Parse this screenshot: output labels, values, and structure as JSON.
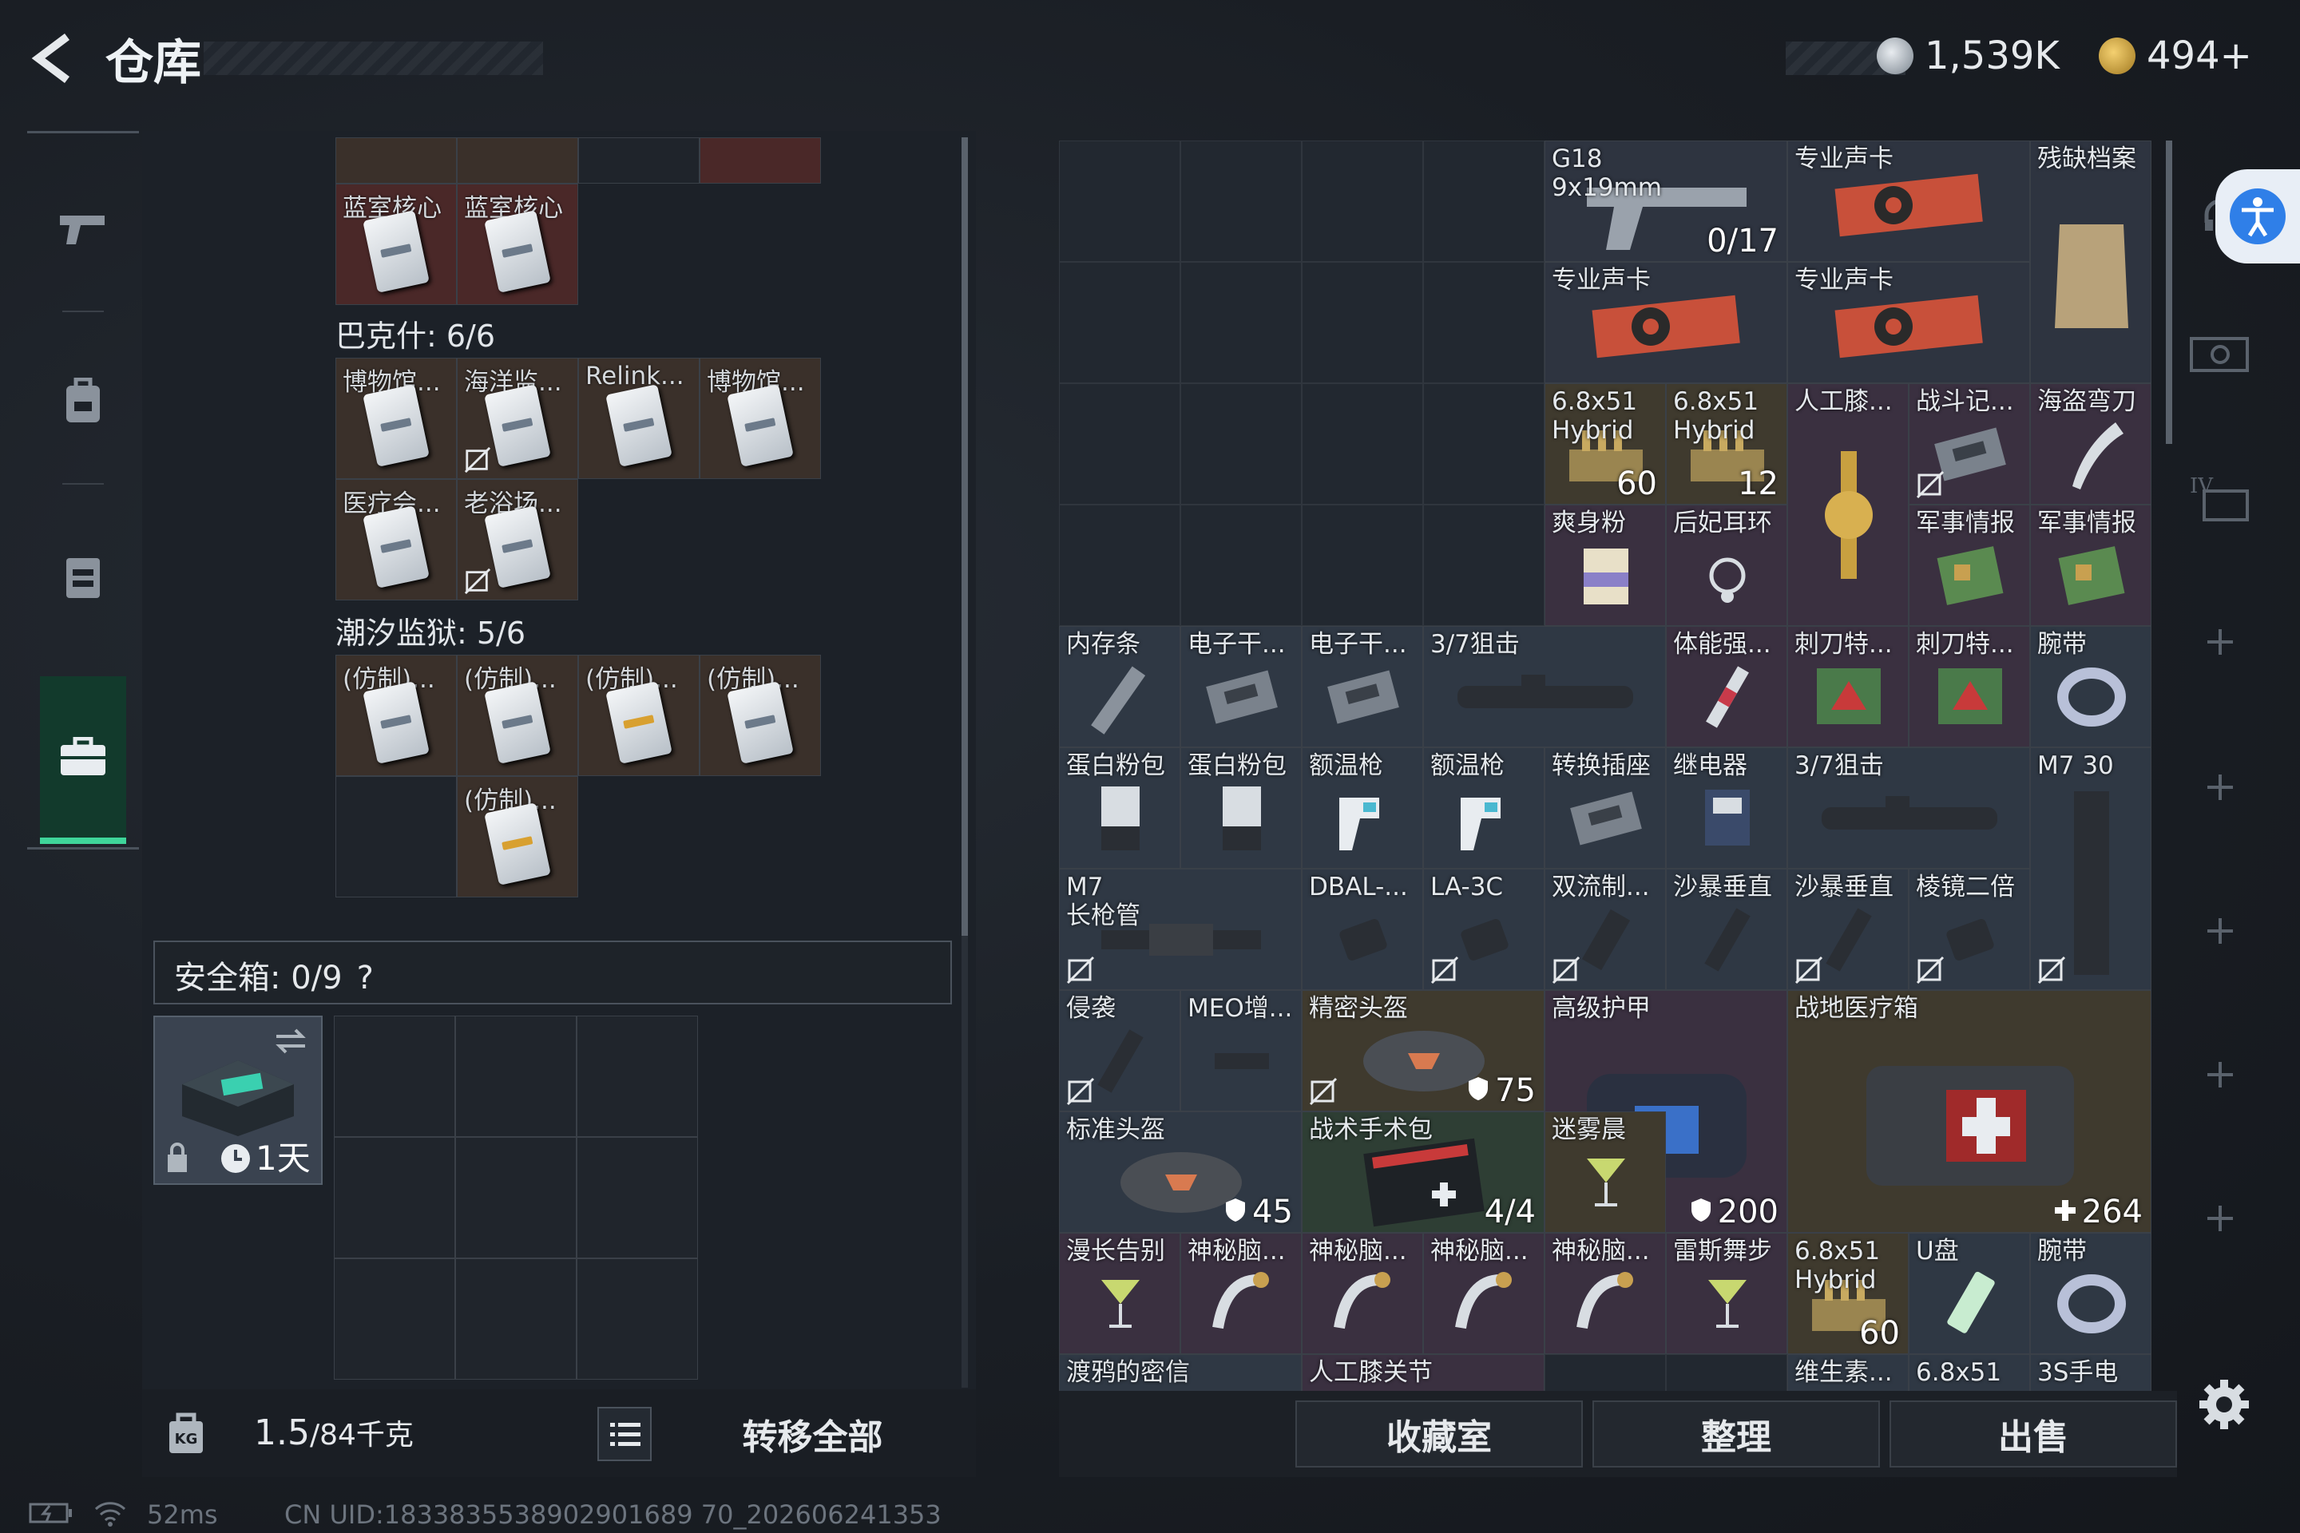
{
  "header": {
    "title": "仓库",
    "currency1": "1,539K",
    "currency2": "494+"
  },
  "left": {
    "top_row": [
      {
        "label": "",
        "color": "brown"
      },
      {
        "label": "",
        "color": "brown"
      },
      {
        "label": "",
        "color": "empty"
      },
      {
        "label": "",
        "color": "red"
      }
    ],
    "top_items": [
      {
        "label": "蓝室核心"
      },
      {
        "label": "蓝室核心"
      }
    ],
    "section1": "巴克什: 6/6",
    "grid1": [
      {
        "label": "博物馆...",
        "nt": false
      },
      {
        "label": "海洋监...",
        "nt": true
      },
      {
        "label": "Relink...",
        "nt": false
      },
      {
        "label": "博物馆...",
        "nt": false
      },
      {
        "label": "医疗会...",
        "nt": false
      },
      {
        "label": "老浴场...",
        "nt": true
      }
    ],
    "section2": "潮汐监狱: 5/6",
    "grid2": [
      {
        "label": "(仿制)...",
        "gold": false
      },
      {
        "label": "(仿制)...",
        "gold": false
      },
      {
        "label": "(仿制)...",
        "gold": true
      },
      {
        "label": "(仿制)...",
        "gold": false
      },
      {
        "label": "",
        "gold": false,
        "empty": true
      },
      {
        "label": "(仿制)...",
        "gold": true
      }
    ],
    "safe_label": "安全箱:  0/9",
    "safe_help": "?",
    "safebox_time": "1天",
    "weight": "1.5",
    "weight_cap": "/84千克",
    "transfer_all": "转移全部"
  },
  "right": {
    "items": [
      {
        "label": "G18\n9x19mm",
        "count": "0/17",
        "c": 6,
        "r": 0,
        "w": 2,
        "h": 1,
        "bg": "#2e3440",
        "icon": "pistol"
      },
      {
        "label": "专业声卡",
        "count": "",
        "c": 8,
        "r": 0,
        "w": 2,
        "h": 1,
        "bg": "#2e3440",
        "icon": "gpu"
      },
      {
        "label": "残缺档案",
        "count": "",
        "c": 10,
        "r": 0,
        "w": 1,
        "h": 2,
        "bg": "#2e3440",
        "icon": "bag"
      },
      {
        "label": "专业声卡",
        "count": "",
        "c": 6,
        "r": 1,
        "w": 2,
        "h": 1,
        "bg": "#2e3440",
        "icon": "gpu"
      },
      {
        "label": "专业声卡",
        "count": "",
        "c": 8,
        "r": 1,
        "w": 2,
        "h": 1,
        "bg": "#2e3440",
        "icon": "gpu"
      },
      {
        "label": "6.8x51\nHybrid",
        "count": "60",
        "c": 6,
        "r": 2,
        "w": 1,
        "h": 1,
        "bg": "#3f3a2e",
        "icon": "ammo"
      },
      {
        "label": "6.8x51\nHybrid",
        "count": "12",
        "c": 7,
        "r": 2,
        "w": 1,
        "h": 1,
        "bg": "#3f3a2e",
        "icon": "ammo"
      },
      {
        "label": "人工膝...",
        "count": "",
        "c": 8,
        "r": 2,
        "w": 1,
        "h": 2,
        "bg": "#3a3040",
        "icon": "knee"
      },
      {
        "label": "战斗记...",
        "count": "",
        "c": 9,
        "r": 2,
        "w": 1,
        "h": 1,
        "bg": "#3a3040",
        "icon": "device",
        "nt": true
      },
      {
        "label": "海盗弯刀",
        "count": "",
        "c": 10,
        "r": 2,
        "w": 1,
        "h": 1,
        "bg": "#3a3040",
        "icon": "knife"
      },
      {
        "label": "爽身粉",
        "count": "",
        "c": 6,
        "r": 3,
        "w": 1,
        "h": 1,
        "bg": "#3a3040",
        "icon": "can"
      },
      {
        "label": "后妃耳环",
        "count": "",
        "c": 7,
        "r": 3,
        "w": 1,
        "h": 1,
        "bg": "#3a3040",
        "icon": "earring"
      },
      {
        "label": "军事情报",
        "count": "",
        "c": 9,
        "r": 3,
        "w": 1,
        "h": 1,
        "bg": "#3a3040",
        "icon": "board"
      },
      {
        "label": "军事情报",
        "count": "",
        "c": 10,
        "r": 3,
        "w": 1,
        "h": 1,
        "bg": "#3a3040",
        "icon": "board"
      },
      {
        "label": "内存条",
        "count": "",
        "c": 2,
        "r": 4,
        "w": 1,
        "h": 1,
        "bg": "#2f3844",
        "icon": "stick"
      },
      {
        "label": "电子干...",
        "count": "",
        "c": 3,
        "r": 4,
        "w": 1,
        "h": 1,
        "bg": "#2f3844",
        "icon": "device"
      },
      {
        "label": "电子干...",
        "count": "",
        "c": 4,
        "r": 4,
        "w": 1,
        "h": 1,
        "bg": "#2f3844",
        "icon": "device"
      },
      {
        "label": "3/7狙击",
        "count": "",
        "c": 5,
        "r": 4,
        "w": 2,
        "h": 1,
        "bg": "#2f3844",
        "icon": "scope"
      },
      {
        "label": "体能强...",
        "count": "",
        "c": 7,
        "r": 4,
        "w": 1,
        "h": 1,
        "bg": "#3a3040",
        "icon": "syringe"
      },
      {
        "label": "刺刀特...",
        "count": "",
        "c": 8,
        "r": 4,
        "w": 1,
        "h": 1,
        "bg": "#3a3040",
        "icon": "pack"
      },
      {
        "label": "刺刀特...",
        "count": "",
        "c": 9,
        "r": 4,
        "w": 1,
        "h": 1,
        "bg": "#3a3040",
        "icon": "pack"
      },
      {
        "label": "腕带",
        "count": "",
        "c": 10,
        "r": 4,
        "w": 1,
        "h": 1,
        "bg": "#2f3844",
        "icon": "band"
      },
      {
        "label": "蛋白粉包",
        "count": "",
        "c": 2,
        "r": 5,
        "w": 1,
        "h": 1,
        "bg": "#2f3844",
        "icon": "pouch"
      },
      {
        "label": "蛋白粉包",
        "count": "",
        "c": 3,
        "r": 5,
        "w": 1,
        "h": 1,
        "bg": "#2f3844",
        "icon": "pouch"
      },
      {
        "label": "额温枪",
        "count": "",
        "c": 4,
        "r": 5,
        "w": 1,
        "h": 1,
        "bg": "#2f3844",
        "icon": "thermo"
      },
      {
        "label": "额温枪",
        "count": "",
        "c": 5,
        "r": 5,
        "w": 1,
        "h": 1,
        "bg": "#2f3844",
        "icon": "thermo"
      },
      {
        "label": "转换插座",
        "count": "",
        "c": 6,
        "r": 5,
        "w": 1,
        "h": 1,
        "bg": "#2f3844",
        "icon": "device"
      },
      {
        "label": "继电器",
        "count": "",
        "c": 7,
        "r": 5,
        "w": 1,
        "h": 1,
        "bg": "#2f3844",
        "icon": "relay"
      },
      {
        "label": "3/7狙击",
        "count": "",
        "c": 8,
        "r": 5,
        "w": 2,
        "h": 1,
        "bg": "#2f3844",
        "icon": "scope"
      },
      {
        "label": "M7 30",
        "count": "",
        "c": 10,
        "r": 5,
        "w": 1,
        "h": 2,
        "bg": "#2f3844",
        "icon": "mag",
        "nt": true
      },
      {
        "label": "M7\n长枪管",
        "count": "",
        "c": 2,
        "r": 6,
        "w": 2,
        "h": 1,
        "bg": "#2f3844",
        "icon": "barrel",
        "nt": true
      },
      {
        "label": "DBAL-...",
        "count": "",
        "c": 4,
        "r": 6,
        "w": 1,
        "h": 1,
        "bg": "#2f3844",
        "icon": "laser"
      },
      {
        "label": "LA-3C",
        "count": "",
        "c": 5,
        "r": 6,
        "w": 1,
        "h": 1,
        "bg": "#2f3844",
        "icon": "laser",
        "nt": true
      },
      {
        "label": "双流制...",
        "count": "",
        "c": 6,
        "r": 6,
        "w": 1,
        "h": 1,
        "bg": "#2f3844",
        "icon": "muzzle",
        "nt": true
      },
      {
        "label": "沙暴垂直",
        "count": "",
        "c": 7,
        "r": 6,
        "w": 1,
        "h": 1,
        "bg": "#2f3844",
        "icon": "grip"
      },
      {
        "label": "沙暴垂直",
        "count": "",
        "c": 8,
        "r": 6,
        "w": 1,
        "h": 1,
        "bg": "#2f3844",
        "icon": "grip",
        "nt": true
      },
      {
        "label": "棱镜二倍",
        "count": "",
        "c": 9,
        "r": 6,
        "w": 1,
        "h": 1,
        "bg": "#2f3844",
        "icon": "laser",
        "nt": true
      },
      {
        "label": "侵袭",
        "count": "",
        "c": 2,
        "r": 7,
        "w": 1,
        "h": 1,
        "bg": "#2f3844",
        "icon": "grip",
        "nt": true
      },
      {
        "label": "MEO增...",
        "count": "",
        "c": 3,
        "r": 7,
        "w": 1,
        "h": 1,
        "bg": "#2f3844",
        "icon": "rail"
      },
      {
        "label": "精密头盔",
        "count": "75",
        "c": 4,
        "r": 7,
        "w": 2,
        "h": 1,
        "bg": "#3f3a2e",
        "icon": "helmet",
        "nt": true,
        "shield": true
      },
      {
        "label": "高级护甲",
        "count": "200",
        "c": 6,
        "r": 7,
        "w": 2,
        "h": 2,
        "bg": "#3a3040",
        "icon": "armor",
        "nt": true,
        "shield": true
      },
      {
        "label": "战地医疗箱",
        "count": "264",
        "c": 8,
        "r": 7,
        "w": 3,
        "h": 2,
        "bg": "#3f3a2e",
        "icon": "medkit",
        "plus": true
      },
      {
        "label": "标准头盔",
        "count": "45",
        "c": 2,
        "r": 8,
        "w": 2,
        "h": 1,
        "bg": "#2f3844",
        "icon": "helmet",
        "shield": true
      },
      {
        "label": "战术手术包",
        "count": "4/4",
        "c": 4,
        "r": 8,
        "w": 2,
        "h": 1,
        "bg": "#2e3e34",
        "icon": "surgery"
      },
      {
        "label": "迷雾晨",
        "count": "",
        "c": 6,
        "r": 8,
        "w": 1,
        "h": 1,
        "bg": "#3f3a2e",
        "icon": "cocktail"
      },
      {
        "label": "漫长告别",
        "count": "",
        "c": 2,
        "r": 9,
        "w": 1,
        "h": 1,
        "bg": "#3a3040",
        "icon": "cocktail"
      },
      {
        "label": "神秘脑...",
        "count": "",
        "c": 3,
        "r": 9,
        "w": 1,
        "h": 1,
        "bg": "#3a3040",
        "icon": "brain"
      },
      {
        "label": "神秘脑...",
        "count": "",
        "c": 4,
        "r": 9,
        "w": 1,
        "h": 1,
        "bg": "#3a3040",
        "icon": "brain"
      },
      {
        "label": "神秘脑...",
        "count": "",
        "c": 5,
        "r": 9,
        "w": 1,
        "h": 1,
        "bg": "#3a3040",
        "icon": "brain"
      },
      {
        "label": "神秘脑...",
        "count": "",
        "c": 6,
        "r": 9,
        "w": 1,
        "h": 1,
        "bg": "#3a3040",
        "icon": "brain"
      },
      {
        "label": "雷斯舞步",
        "count": "",
        "c": 7,
        "r": 9,
        "w": 1,
        "h": 1,
        "bg": "#3a3040",
        "icon": "cocktail"
      },
      {
        "label": "6.8x51\nHybrid",
        "count": "60",
        "c": 8,
        "r": 9,
        "w": 1,
        "h": 1,
        "bg": "#3f3a2e",
        "icon": "ammo"
      },
      {
        "label": "U盘",
        "count": "",
        "c": 9,
        "r": 9,
        "w": 1,
        "h": 1,
        "bg": "#2f3844",
        "icon": "usb"
      },
      {
        "label": "腕带",
        "count": "",
        "c": 10,
        "r": 9,
        "w": 1,
        "h": 1,
        "bg": "#2f3844",
        "icon": "band"
      },
      {
        "label": "渡鸦的密信",
        "count": "",
        "c": 2,
        "r": 10,
        "w": 2,
        "h": 1,
        "bg": "#2f3844",
        "icon": ""
      },
      {
        "label": "人工膝关节",
        "count": "",
        "c": 4,
        "r": 10,
        "w": 2,
        "h": 1,
        "bg": "#3a3040",
        "icon": ""
      },
      {
        "label": "维生素...",
        "count": "",
        "c": 8,
        "r": 10,
        "w": 1,
        "h": 1,
        "bg": "#2f3844",
        "icon": ""
      },
      {
        "label": "6.8x51",
        "count": "",
        "c": 9,
        "r": 10,
        "w": 1,
        "h": 1,
        "bg": "#2f3844",
        "icon": ""
      },
      {
        "label": "3S手电",
        "count": "",
        "c": 10,
        "r": 10,
        "w": 1,
        "h": 1,
        "bg": "#2f3844",
        "icon": ""
      }
    ],
    "btn_collection": "收藏室",
    "btn_sort": "整理",
    "btn_sell": "出售"
  },
  "status": {
    "ping": "52ms",
    "uid": "CN UID:1833835538902901689 70_202606241353"
  },
  "colors": {
    "accent": "#3fd59a"
  }
}
